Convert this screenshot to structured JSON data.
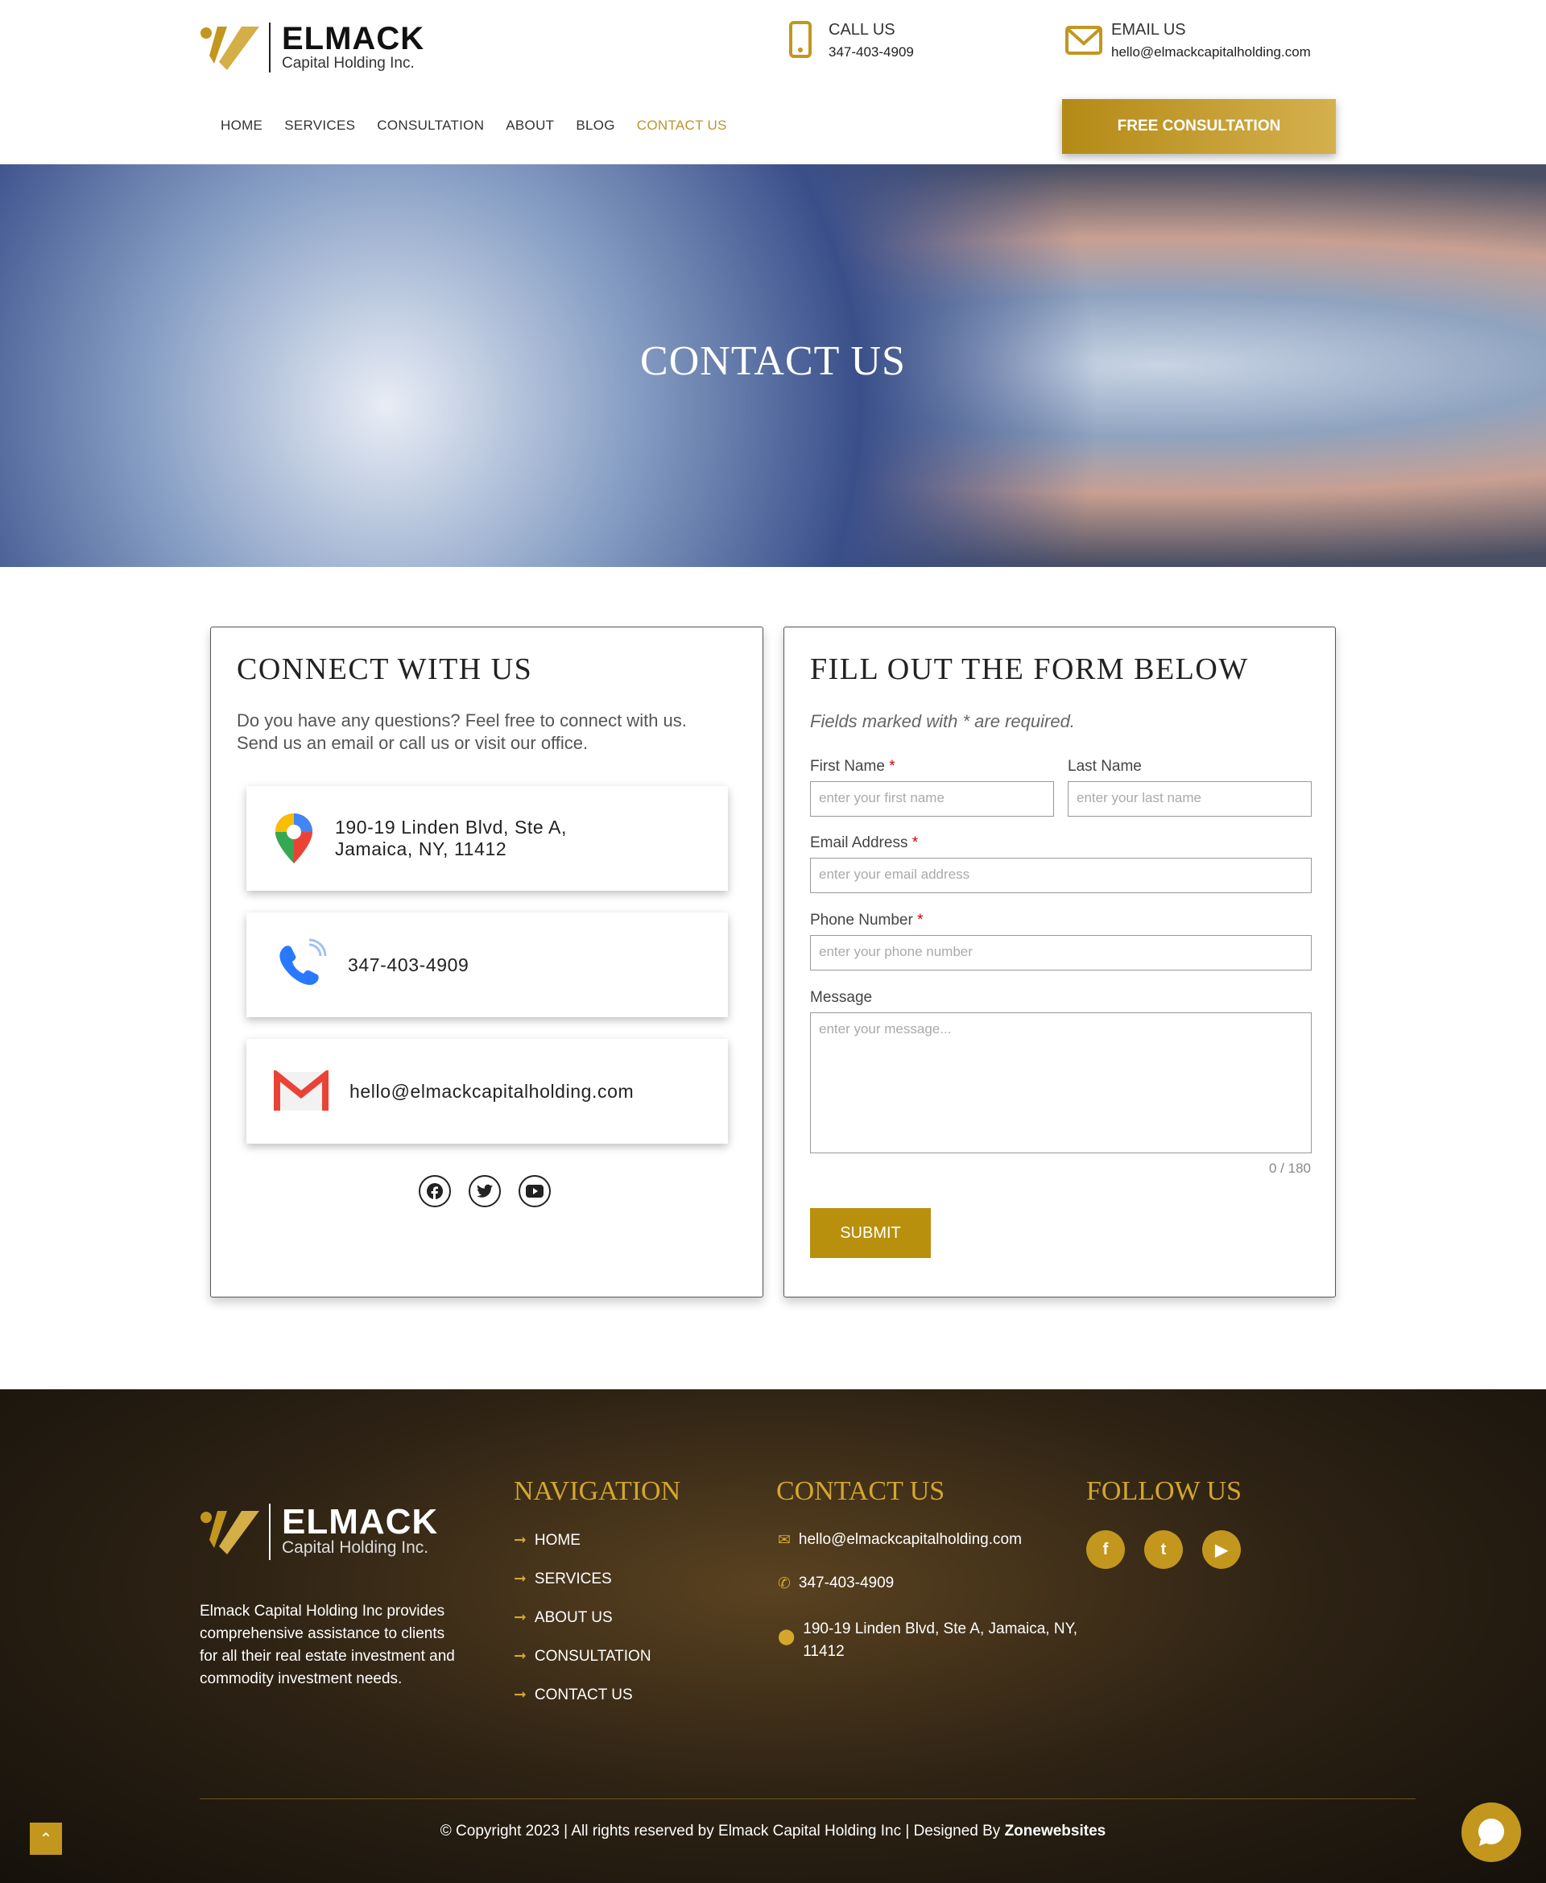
{
  "header": {
    "logo_word": "ELMACK",
    "logo_sub": "Capital Holding Inc.",
    "call_label": "CALL US",
    "call_value": "347-403-4909",
    "email_label": "EMAIL US",
    "email_value": "hello@elmackcapitalholding.com",
    "nav": [
      "HOME",
      "SERVICES",
      "CONSULTATION",
      "ABOUT",
      "BLOG",
      "CONTACT US"
    ],
    "cta": "FREE CONSULTATION"
  },
  "hero": {
    "title": "CONTACT US"
  },
  "connect": {
    "title": "CONNECT WITH US",
    "intro": "Do you have any questions? Feel free to connect with us. Send us an email or call us or visit our office.",
    "address": "190-19 Linden Blvd, Ste A, Jamaica, NY, 11412",
    "phone": "347-403-4909",
    "email": "hello@elmackcapitalholding.com",
    "social": [
      "facebook-icon",
      "twitter-icon",
      "youtube-icon"
    ]
  },
  "form": {
    "title": "FILL OUT THE FORM BELOW",
    "note": "Fields marked with * are required.",
    "first_label": "First Name",
    "first_ph": "enter your first name",
    "last_label": "Last Name",
    "last_ph": "enter your last name",
    "email_label": "Email Address",
    "email_ph": "enter your email address",
    "phone_label": "Phone Number",
    "phone_ph": "enter your phone number",
    "msg_label": "Message",
    "msg_ph": "enter your message...",
    "counter": "0 / 180",
    "submit": "SUBMIT"
  },
  "footer": {
    "desc": "Elmack Capital Holding Inc provides comprehensive assistance to clients for all their real estate investment and commodity investment needs.",
    "nav_title": "NAVIGATION",
    "nav": [
      "HOME",
      "SERVICES",
      "ABOUT US",
      "CONSULTATION",
      "CONTACT US"
    ],
    "contact_title": "CONTACT US",
    "email": "hello@elmackcapitalholding.com",
    "phone": "347-403-4909",
    "address": "190-19 Linden Blvd, Ste A, Jamaica, NY, 11412",
    "follow_title": "FOLLOW US",
    "copyright": "© Copyright 2023 | All rights reserved by Elmack Capital Holding Inc | Designed By ",
    "designer": "Zonewebsites"
  },
  "colors": {
    "accent": "#b8962e",
    "gold": "#c3961e"
  }
}
